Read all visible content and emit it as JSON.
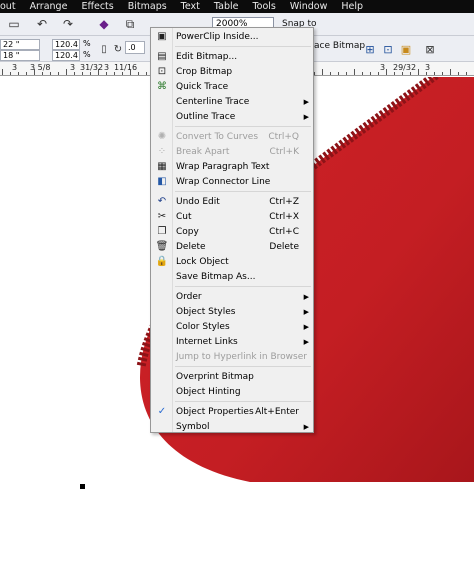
{
  "menubar": [
    "out",
    "Arrange",
    "Effects",
    "Bitmaps",
    "Text",
    "Table",
    "Tools",
    "Window",
    "Help"
  ],
  "toolbar": {
    "zoom": "2000%",
    "snap": "Snap to"
  },
  "propbar": {
    "pos_x": "22 \"",
    "pos_y": "18 \"",
    "scale_x": "120.4",
    "scale_y": "120.4",
    "pct": "%",
    "rotation": ".0",
    "trace_bitmap": "ace Bitmap"
  },
  "ruler": [
    "3",
    "3 5/8",
    "3",
    "31/32",
    "3",
    "11/16",
    "3",
    "29/32",
    "3"
  ],
  "colors": {
    "shape": "#c41e23",
    "shape_dark": "#8d1317",
    "menubar": "#0c0c0c"
  },
  "context_menu": {
    "items": [
      {
        "label": "PowerClip Inside...",
        "icon": "powerclip-icon"
      },
      {
        "label": "Edit Bitmap...",
        "icon": "edit-bitmap-icon"
      },
      {
        "label": "Crop Bitmap",
        "icon": "crop-icon"
      },
      {
        "label": "Quick Trace",
        "icon": "quick-trace-icon"
      },
      {
        "label": "Centerline Trace",
        "submenu": true
      },
      {
        "label": "Outline Trace",
        "submenu": true
      },
      {
        "label": "Convert To Curves",
        "shortcut": "Ctrl+Q",
        "disabled": true,
        "icon": "convert-curves-icon"
      },
      {
        "label": "Break Apart",
        "shortcut": "Ctrl+K",
        "disabled": true,
        "icon": "break-apart-icon"
      },
      {
        "label": "Wrap Paragraph Text",
        "icon": "wrap-text-icon"
      },
      {
        "label": "Wrap Connector Line",
        "icon": "wrap-connector-icon"
      },
      {
        "label": "Undo Edit",
        "shortcut": "Ctrl+Z",
        "icon": "undo-icon"
      },
      {
        "label": "Cut",
        "shortcut": "Ctrl+X",
        "icon": "scissors-icon"
      },
      {
        "label": "Copy",
        "shortcut": "Ctrl+C",
        "icon": "copy-icon"
      },
      {
        "label": "Delete",
        "shortcut": "Delete",
        "icon": "trash-icon"
      },
      {
        "label": "Lock Object",
        "icon": "lock-icon"
      },
      {
        "label": "Save Bitmap As..."
      },
      {
        "label": "Order",
        "submenu": true
      },
      {
        "label": "Object Styles",
        "submenu": true
      },
      {
        "label": "Color Styles",
        "submenu": true
      },
      {
        "label": "Internet Links",
        "submenu": true
      },
      {
        "label": "Jump to Hyperlink in Browser",
        "disabled": true
      },
      {
        "label": "Overprint Bitmap"
      },
      {
        "label": "Object Hinting"
      },
      {
        "label": "Object Properties",
        "shortcut": "Alt+Enter",
        "checked": true
      },
      {
        "label": "Symbol",
        "submenu": true
      }
    ]
  }
}
